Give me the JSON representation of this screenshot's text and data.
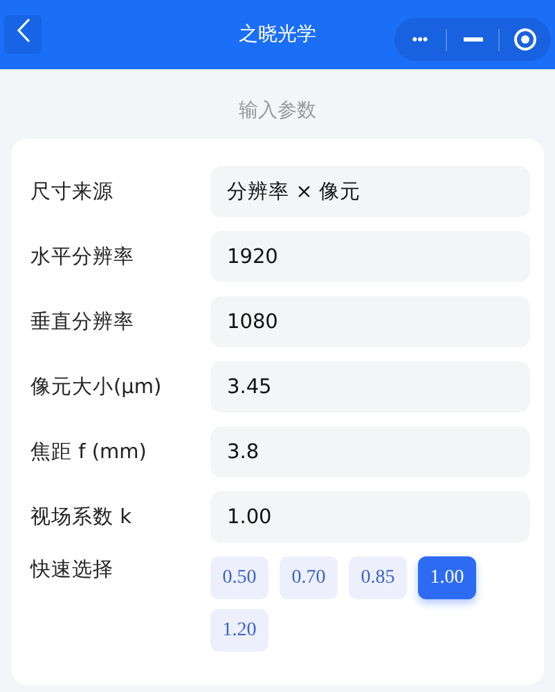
{
  "nav_bar": {
    "title": "之晓光学",
    "more": "•••"
  },
  "section_title": "输入参数",
  "fields": [
    {
      "label": "尺寸来源",
      "value": "分辨率 × 像元"
    },
    {
      "label": "水平分辨率",
      "value": "1920"
    },
    {
      "label": "垂直分辨率",
      "value": "1080"
    },
    {
      "label": "像元大小(μm)",
      "value": "3.45"
    },
    {
      "label": "焦距 f (mm)",
      "value": "3.8"
    },
    {
      "label": "视场系数 k",
      "value": "1.00"
    }
  ],
  "quick_select": {
    "label": "快速选择",
    "options": [
      {
        "label": "0.50",
        "selected": false
      },
      {
        "label": "0.70",
        "selected": false
      },
      {
        "label": "0.85",
        "selected": false
      },
      {
        "label": "1.00",
        "selected": true
      },
      {
        "label": "1.20",
        "selected": false
      }
    ]
  }
}
